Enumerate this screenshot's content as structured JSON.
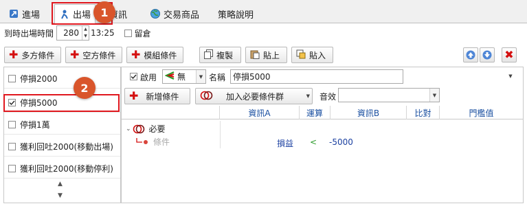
{
  "tabs": [
    {
      "label": "進場",
      "icon": "enter-arrow-icon"
    },
    {
      "label": "出場",
      "icon": "exit-person-icon"
    },
    {
      "label": "資訊",
      "icon": "info-icon"
    },
    {
      "label": "交易商品",
      "icon": "globe-icon"
    },
    {
      "label": "策略說明",
      "icon": ""
    }
  ],
  "badges": [
    "1",
    "2"
  ],
  "exit_time": {
    "label": "到時出場時間",
    "value": "280",
    "time": "13:25",
    "hold_label": "留倉"
  },
  "toolbar": {
    "long_label": "多方條件",
    "short_label": "空方條件",
    "module_label": "模組條件",
    "copy_label": "複製",
    "paste_on_label": "貼上",
    "paste_in_label": "貼入"
  },
  "left_list": {
    "items": [
      {
        "label": "停損2000",
        "checked": false
      },
      {
        "label": "停損5000",
        "checked": true
      },
      {
        "label": "停損1萬",
        "checked": false
      },
      {
        "label": "獲利回吐2000(移動出場)",
        "checked": false
      },
      {
        "label": "獲利回吐2000(移動停利)",
        "checked": false
      }
    ]
  },
  "detail": {
    "enable_label": "啟用",
    "signal_value": "無",
    "name_label": "名稱",
    "name_value": "停損5000",
    "add_condition_label": "新增條件",
    "add_group_label": "加入必要條件群",
    "sound_label": "音效",
    "sound_value": ""
  },
  "grid": {
    "headers": [
      "資訊A",
      "運算",
      "資訊B",
      "比對",
      "門檻值"
    ],
    "group_label": "必要",
    "condition_label": "條件",
    "row": {
      "info_a": "損益",
      "op": "<",
      "info_b": "-5000"
    }
  },
  "colors": {
    "highlight_red": "#e0161d",
    "badge_orange": "#d9552b",
    "header_blue": "#1a4fa0"
  }
}
